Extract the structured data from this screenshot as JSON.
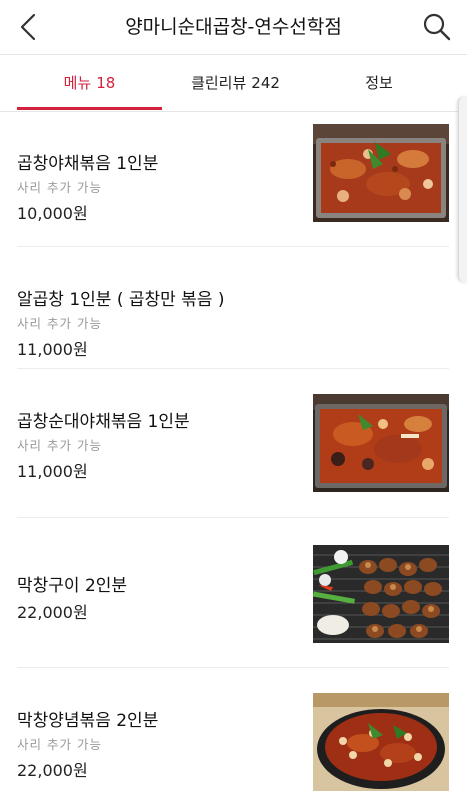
{
  "header": {
    "title": "양마니순대곱창-연수선학점",
    "back_icon": "chevron-left-icon",
    "search_icon": "search-icon"
  },
  "tabs": [
    {
      "label": "메뉴",
      "count": "18",
      "active": true
    },
    {
      "label": "클린리뷰",
      "count": "242",
      "active": false
    },
    {
      "label": "정보",
      "count": "",
      "active": false
    }
  ],
  "colors": {
    "accent": "#d2223c",
    "text": "#222222",
    "muted": "#9a9a9a",
    "divider": "#ececec"
  },
  "menu": [
    {
      "name": "곱창야채볶음 1인분",
      "note": "사리 추가 가능",
      "price": "10,000원",
      "image": "grilled-tripe-vegetables-photo"
    },
    {
      "name": "알곱창 1인분 ( 곱창만 볶음 )",
      "note": "사리 추가 가능",
      "price": "11,000원",
      "image": ""
    },
    {
      "name": "곱창순대야채볶음 1인분",
      "note": "사리 추가 가능",
      "price": "11,000원",
      "image": "tripe-sundae-stirfry-photo"
    },
    {
      "name": "막창구이 2인분",
      "note": "",
      "price": "22,000원",
      "image": "grilled-makchang-photo"
    },
    {
      "name": "막창양념볶음 2인분",
      "note": "사리 추가 가능",
      "price": "22,000원",
      "image": "spicy-makchang-pan-photo"
    }
  ]
}
